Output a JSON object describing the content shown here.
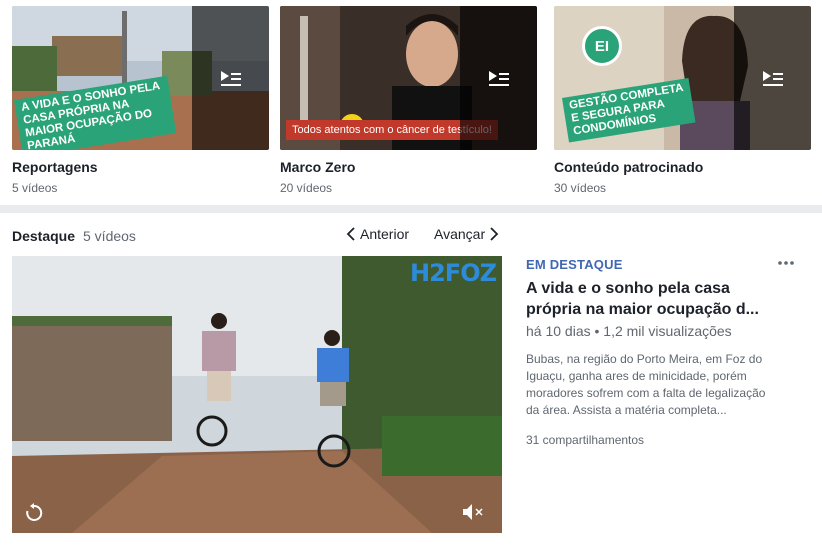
{
  "playlists": [
    {
      "title": "Reportagens",
      "count": "5 vídeos",
      "banner": "A vida e o sonho pela casa própria na maior ocupação do Paraná"
    },
    {
      "title": "Marco Zero",
      "count": "20 vídeos",
      "banner": "Todos atentos com o câncer de testículo!"
    },
    {
      "title": "Conteúdo patrocinado",
      "count": "30 vídeos",
      "banner": "Gestão completa e segura para condomínios",
      "badge": "EI"
    }
  ],
  "featured_section": {
    "title": "Destaque",
    "count": "5 vídeos",
    "prev_label": "Anterior",
    "next_label": "Avançar"
  },
  "featured_video": {
    "brand": "H2FOZ",
    "label": "EM DESTAQUE",
    "title": "A vida e o sonho pela casa própria na maior ocupação d...",
    "meta": "há 10 dias • 1,2 mil visualizações",
    "description": "Bubas, na região do Porto Meira, em Foz do Iguaçu, ganha ares de minicidade, porém moradores sofrem com a falta de legalização da área. Assista a matéria completa...",
    "shares": "31 compartilhamentos"
  },
  "icons": {
    "playlist": "playlist-play-icon",
    "prev": "chevron-left-icon",
    "next": "chevron-right-icon",
    "more": "more-options-icon",
    "replay": "replay-icon",
    "mute": "volume-muted-icon"
  },
  "colors": {
    "link": "#4267b2",
    "banner_green": "#2aa378",
    "banner_red": "#c0392b",
    "brand_blue": "#2e8bd8"
  }
}
